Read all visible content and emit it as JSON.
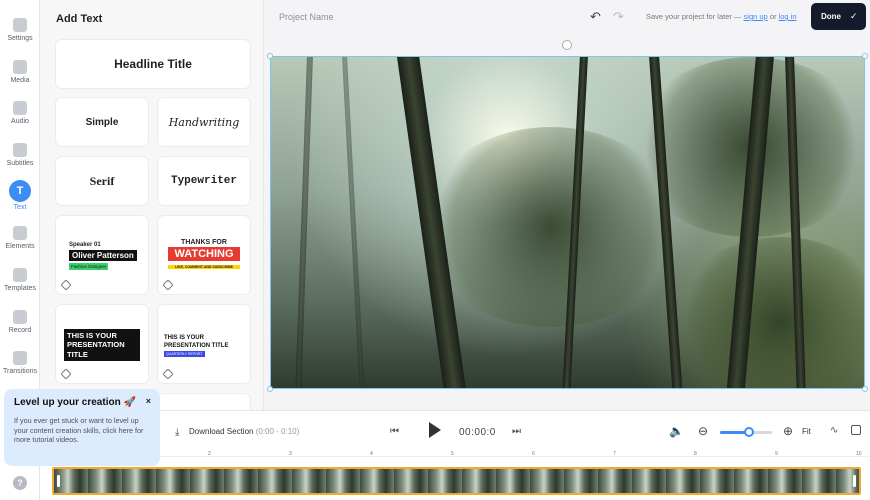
{
  "rail": {
    "items": [
      {
        "label": "Settings",
        "icon": "gear-icon"
      },
      {
        "label": "Media",
        "icon": "plus-icon"
      },
      {
        "label": "Audio",
        "icon": "music-icon"
      },
      {
        "label": "Subtitles",
        "icon": "subtitles-icon"
      },
      {
        "label": "Text",
        "icon": "text-icon",
        "glyph": "T",
        "active": true
      },
      {
        "label": "Elements",
        "icon": "elements-icon"
      },
      {
        "label": "Templates",
        "icon": "templates-icon"
      },
      {
        "label": "Record",
        "icon": "record-icon"
      },
      {
        "label": "Transitions",
        "icon": "transitions-icon"
      }
    ],
    "help_glyph": "?"
  },
  "panel": {
    "title": "Add Text",
    "styles": {
      "headline": "Headline Title",
      "simple": "Simple",
      "handwriting": "Handwriting",
      "serif": "Serif",
      "typewriter": "Typewriter"
    },
    "templates": {
      "t1": {
        "speaker": "Speaker 01",
        "name": "Oliver Patterson",
        "role": "Fashion Designer"
      },
      "t2": {
        "top": "THANKS FOR",
        "big": "WATCHING",
        "sub": "LIKE, COMMENT AND SUBSCRIBE"
      },
      "t3": {
        "text": "THIS IS YOUR PRESENTATION TITLE"
      },
      "t4": {
        "text": "THIS IS YOUR PRESENTATION TITLE",
        "sub": "QUARTERLY REPORT"
      }
    }
  },
  "topbar": {
    "project_placeholder": "Project Name",
    "undo_glyph": "↶",
    "redo_glyph": "↷",
    "save_prefix": "Save your project for later — ",
    "sign_up": "sign up",
    "or": " or ",
    "log_in": "log in",
    "done": "Done",
    "done_chevron": "✓"
  },
  "controls": {
    "download_icon": "⤓",
    "download_label": "Download Section",
    "download_range": " (0:00 - 0:10)",
    "rewind_glyph": "⏮",
    "time": "00:00:0",
    "forward_glyph": "⏭",
    "volume_glyph": "🔈",
    "zoom_out_glyph": "⊖",
    "zoom_in_glyph": "⊕",
    "zoom_level": 0.55,
    "fit": "Fit",
    "wave_glyph": "∿"
  },
  "timeline": {
    "ticks": [
      "1",
      "2",
      "3",
      "4",
      "5",
      "6",
      "7",
      "8",
      "9",
      "10"
    ]
  },
  "toast": {
    "title": "Level up your creation 🚀",
    "close": "×",
    "body": "If you ever get stuck or want to level up your content creation skills, click here for more tutorial videos."
  },
  "colors": {
    "accent": "#3b8cf3",
    "done_bg": "#151a2c",
    "selection": "#7fc3ef",
    "clip_border": "#f0a830"
  }
}
